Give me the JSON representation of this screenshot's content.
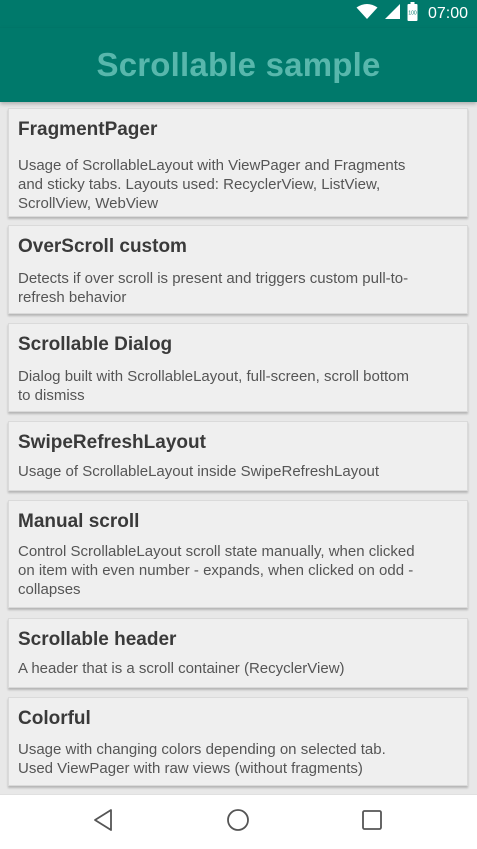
{
  "status_bar": {
    "time": "07:00",
    "battery_label": "100",
    "icons": [
      "wifi-icon",
      "cell-signal-icon",
      "battery-icon"
    ]
  },
  "app_bar": {
    "title": "Scrollable sample",
    "background_color": "#00796b",
    "title_color": "#58b7ac"
  },
  "samples": [
    {
      "title": "FragmentPager",
      "desc": [
        "Usage of ScrollableLayout with ViewPager and Fragments",
        "and sticky tabs. Layouts used: RecyclerView, ListView,",
        "ScrollView, WebView"
      ]
    },
    {
      "title": "OverScroll custom",
      "desc": [
        "Detects if over scroll is present and triggers custom pull-to-",
        "refresh behavior"
      ]
    },
    {
      "title": "Scrollable Dialog",
      "desc": [
        "Dialog built with ScrollableLayout, full-screen, scroll bottom",
        "to dismiss"
      ]
    },
    {
      "title": "SwipeRefreshLayout",
      "desc": [
        "Usage of ScrollableLayout inside SwipeRefreshLayout"
      ]
    },
    {
      "title": "Manual scroll",
      "desc": [
        "Control ScrollableLayout scroll state manually, when clicked",
        "on item with even number - expands, when clicked on odd -",
        "collapses"
      ]
    },
    {
      "title": "Scrollable header",
      "desc": [
        "A header that is a scroll container (RecyclerView)"
      ]
    },
    {
      "title": "Colorful",
      "desc": [
        "Usage with changing colors depending on selected tab.",
        "Used ViewPager with raw views (without fragments)"
      ]
    }
  ],
  "nav_bar": {
    "icons": [
      "back-icon",
      "home-icon",
      "recents-icon"
    ]
  }
}
